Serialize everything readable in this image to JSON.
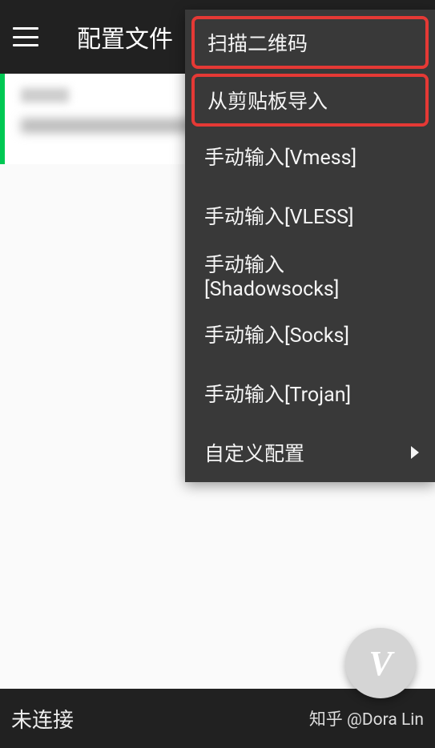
{
  "header": {
    "title": "配置文件"
  },
  "menu": {
    "items": [
      {
        "label": "扫描二维码",
        "highlighted": true
      },
      {
        "label": "从剪贴板导入",
        "highlighted": true
      },
      {
        "label": "手动输入[Vmess]",
        "highlighted": false
      },
      {
        "label": "手动输入[VLESS]",
        "highlighted": false
      },
      {
        "label": "手动输入[Shadowsocks]",
        "highlighted": false
      },
      {
        "label": "手动输入[Socks]",
        "highlighted": false
      },
      {
        "label": "手动输入[Trojan]",
        "highlighted": false
      },
      {
        "label": "自定义配置",
        "highlighted": false,
        "has_arrow": true
      }
    ]
  },
  "footer": {
    "status": "未连接",
    "credit": "知乎 @Dora Lin"
  },
  "fab": {
    "icon_text": "V"
  }
}
